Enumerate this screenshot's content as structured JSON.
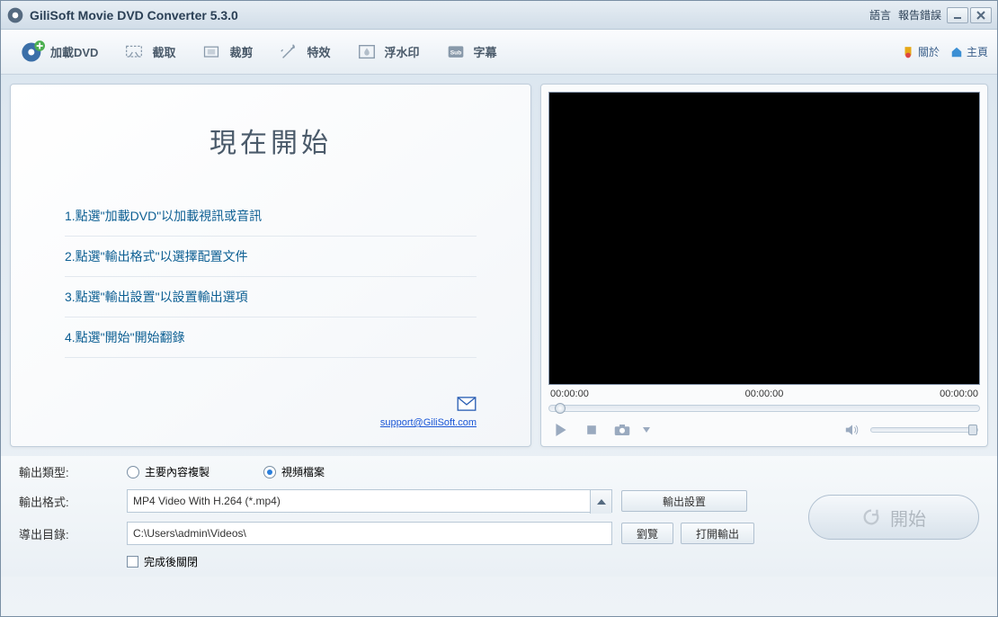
{
  "titlebar": {
    "title": "GiliSoft Movie DVD Converter 5.3.0",
    "links": {
      "language": "語言",
      "report": "報告錯誤"
    }
  },
  "toolbar": {
    "load": "加載DVD",
    "capture": "截取",
    "crop": "裁剪",
    "effect": "特效",
    "watermark": "浮水印",
    "subtitle": "字幕",
    "about": "關於",
    "home": "主頁"
  },
  "start_panel": {
    "title": "現在開始",
    "steps": [
      "1.點選\"加載DVD\"以加載視訊或音訊",
      "2.點選\"輸出格式\"以選擇配置文件",
      "3.點選\"輸出設置\"以設置輸出選項",
      "4.點選\"開始\"開始翻錄"
    ],
    "support_email": "support@GiliSoft.com"
  },
  "player": {
    "t1": "00:00:00",
    "t2": "00:00:00",
    "t3": "00:00:00"
  },
  "bottom": {
    "output_type_label": "輸出類型:",
    "radio_main": "主要內容複製",
    "radio_video": "視頻檔案",
    "output_format_label": "輸出格式:",
    "output_format_value": "MP4 Video With H.264 (*.mp4)",
    "output_settings_btn": "輸出設置",
    "export_dir_label": "導出目錄:",
    "export_dir_value": "C:\\Users\\admin\\Videos\\",
    "browse_btn": "劉覽",
    "open_output_btn": "打開輸出",
    "close_when_done": "完成後關閉",
    "start_btn": "開始"
  }
}
